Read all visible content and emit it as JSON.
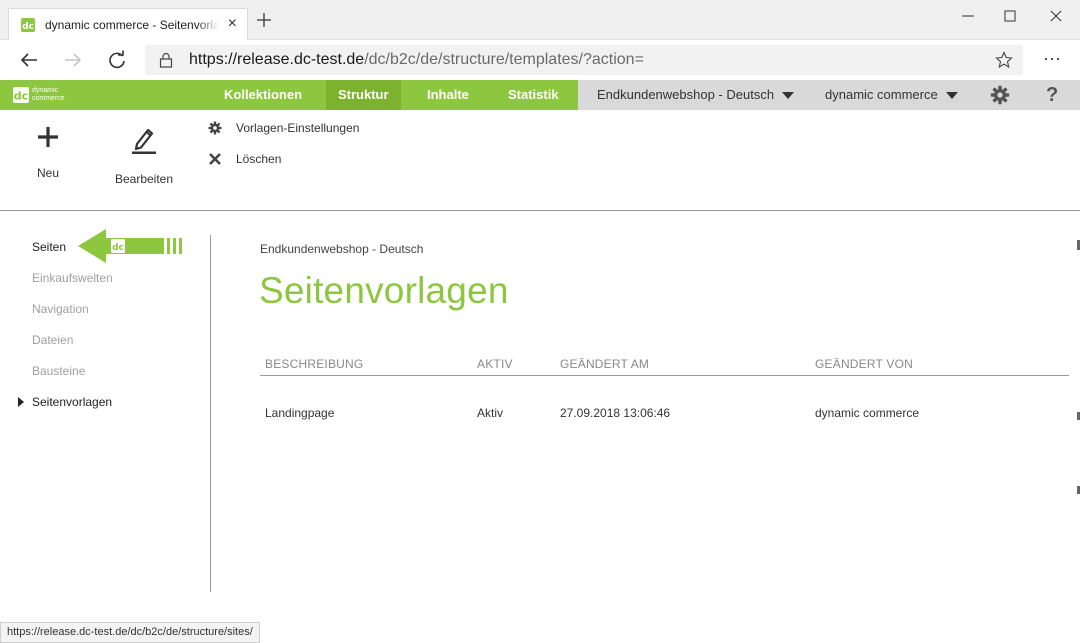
{
  "browser": {
    "tab_title": "dynamic commerce - Seitenvorlagen",
    "tab_close": "×",
    "url_host_prefix": "https://release.dc-test.de",
    "url_path": "/dc/b2c/de/structure/templates/?action=",
    "more": "···"
  },
  "header": {
    "logo_text_line1": "dynamic",
    "logo_text_line2": "commerce",
    "nav": [
      {
        "label": "Kollektionen"
      },
      {
        "label": "Struktur"
      },
      {
        "label": "Inhalte"
      },
      {
        "label": "Statistik"
      }
    ],
    "shop_select": "Endkundenwebshop - Deutsch",
    "company_select": "dynamic commerce",
    "help": "?",
    "colors": {
      "accent": "#8dc63f",
      "accent_dark": "#7cb22d",
      "grey": "#d9d9d9"
    }
  },
  "toolbar": {
    "new_label": "Neu",
    "edit_label": "Bearbeiten",
    "settings_label": "Vorlagen-Einstellungen",
    "delete_label": "Löschen"
  },
  "sidebar": {
    "items": [
      {
        "label": "Seiten"
      },
      {
        "label": "Einkaufswelten"
      },
      {
        "label": "Navigation"
      },
      {
        "label": "Dateien"
      },
      {
        "label": "Bausteine"
      },
      {
        "label": "Seitenvorlagen"
      }
    ]
  },
  "main": {
    "breadcrumb": "Endkundenwebshop - Deutsch",
    "title": "Seitenvorlagen",
    "columns": [
      "BESCHREIBUNG",
      "AKTIV",
      "GEÄNDERT AM",
      "GEÄNDERT VON"
    ],
    "rows": [
      {
        "description": "Landingpage",
        "active": "Aktiv",
        "changed_at": "27.09.2018 13:06:46",
        "changed_by": "dynamic commerce"
      }
    ]
  },
  "status_url": "https://release.dc-test.de/dc/b2c/de/structure/sites/"
}
